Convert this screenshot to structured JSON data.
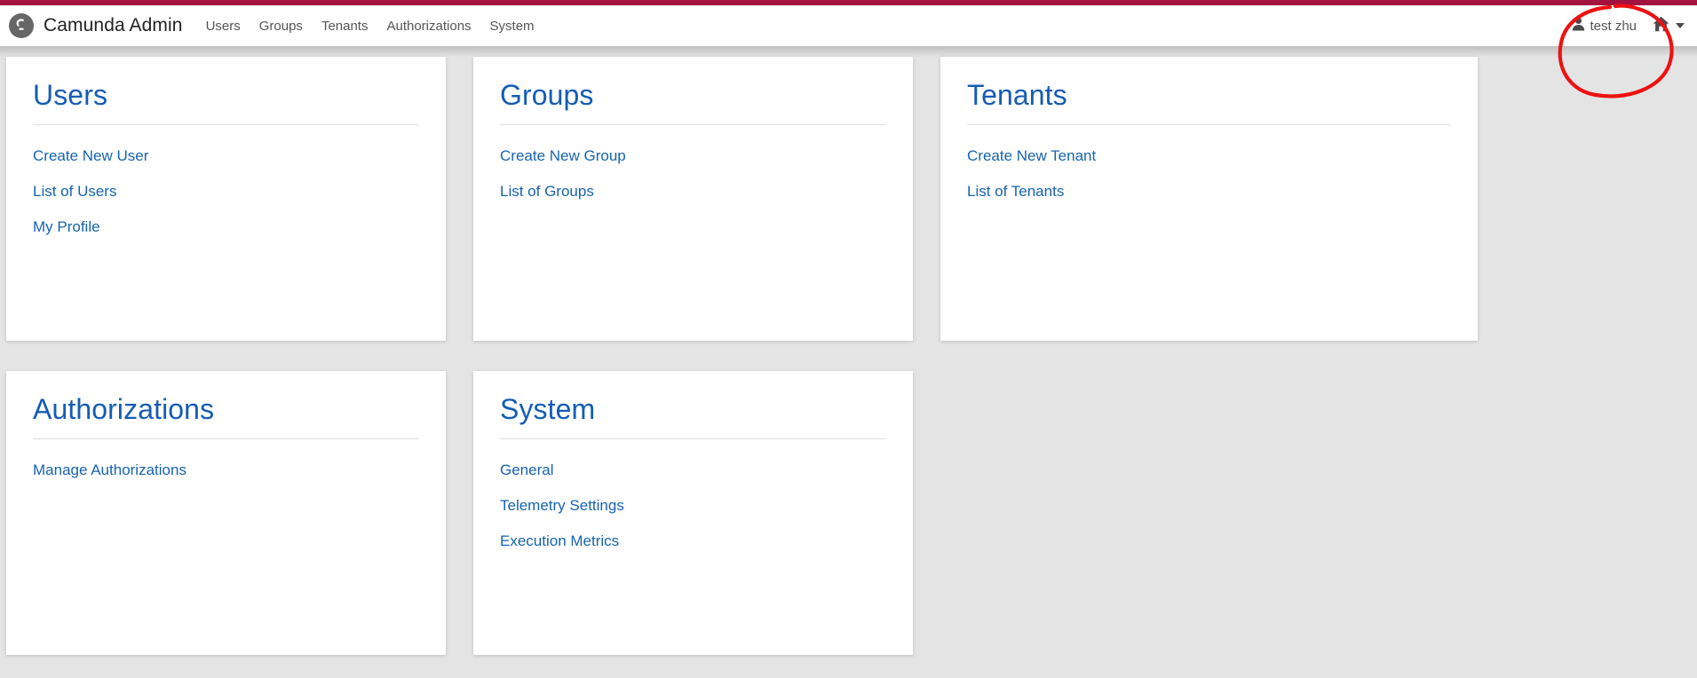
{
  "app": {
    "brand_title": "Camunda Admin",
    "logo_icon": "camunda-logo-icon",
    "accent_red": "#a4123f",
    "link_blue": "#1763b0",
    "title_blue": "#155cb5",
    "background": "#e4e4e4"
  },
  "nav": {
    "items": [
      {
        "label": "Users"
      },
      {
        "label": "Groups"
      },
      {
        "label": "Tenants"
      },
      {
        "label": "Authorizations"
      },
      {
        "label": "System"
      }
    ]
  },
  "header_right": {
    "user_icon": "user-icon",
    "user_name": "test zhu",
    "home_icon": "home-icon",
    "caret_icon": "chevron-down-icon"
  },
  "annotation": {
    "shape": "hand-drawn-ellipse",
    "color": "#ee1111",
    "targets": "test zhu"
  },
  "cards": [
    {
      "title": "Users",
      "links": [
        {
          "label": "Create New User"
        },
        {
          "label": "List of Users"
        },
        {
          "label": "My Profile"
        }
      ]
    },
    {
      "title": "Groups",
      "links": [
        {
          "label": "Create New Group"
        },
        {
          "label": "List of Groups"
        }
      ]
    },
    {
      "title": "Tenants",
      "links": [
        {
          "label": "Create New Tenant"
        },
        {
          "label": "List of Tenants"
        }
      ]
    },
    {
      "title": "Authorizations",
      "links": [
        {
          "label": "Manage Authorizations"
        }
      ]
    },
    {
      "title": "System",
      "links": [
        {
          "label": "General"
        },
        {
          "label": "Telemetry Settings"
        },
        {
          "label": "Execution Metrics"
        }
      ]
    }
  ]
}
